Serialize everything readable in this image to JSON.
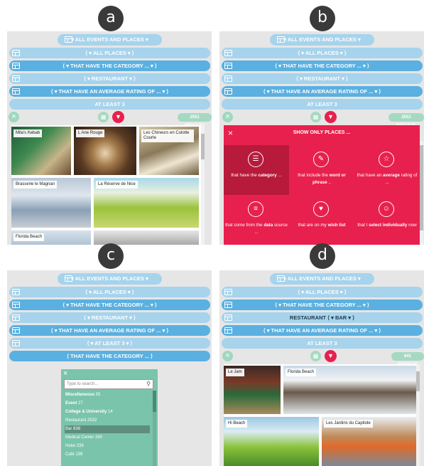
{
  "panels": [
    {
      "letter": "a",
      "bars": [
        "▾ ALL EVENTS AND PLACES ▾",
        "⟨ ▾ ALL PLACES ▾ ⟩",
        "⟨ ▾ THAT HAVE THE CATEGORY ... ▾ ⟩",
        "⟨ ▾ RESTAURANT ▾ ⟩",
        "⟨ ▾ THAT HAVE AN AVERAGE RATING OF ... ▾ ⟩",
        "AT LEAST 3"
      ],
      "results": "2551 RESULTS",
      "photos": [
        "Mila's Kebab",
        "L Ane Rouge",
        "Les Chineurs en Culotte Courte",
        "Brasserie le Magnan",
        "La Réserve de Nice",
        "Florida Beach"
      ]
    },
    {
      "letter": "b",
      "bars": [
        "▾ ALL EVENTS AND PLACES ▾",
        "⟨ ▾ ALL PLACES ▾ ⟩",
        "⟨ ▾ THAT HAVE THE CATEGORY ... ▾ ⟩",
        "⟨ ▾ RESTAURANT ▾ ⟩",
        "⟨ ▾ THAT HAVE AN AVERAGE RATING OF ... ▾ ⟩",
        "AT LEAST 3"
      ],
      "results": "2551 RESULTS",
      "popup_title": "SHOW ONLY PLACES ...",
      "options": [
        {
          "icon": "list-icon",
          "glyph": "☰",
          "pre": "that have the ",
          "bold": "category",
          "post": " ..."
        },
        {
          "icon": "pencil-icon",
          "glyph": "✎",
          "pre": "that include the ",
          "bold": "word or phrase",
          "post": " .."
        },
        {
          "icon": "star-icon",
          "glyph": "☆",
          "pre": "that have an ",
          "bold": "average",
          "post": " rating of ..."
        },
        {
          "icon": "data-source-icon",
          "glyph": "≡",
          "pre": "that come from the ",
          "bold": "data",
          "post": " source ..."
        },
        {
          "icon": "heart-icon",
          "glyph": "♥",
          "pre": "that are on my ",
          "bold": "wish list",
          "post": ""
        },
        {
          "icon": "person-icon",
          "glyph": "☺",
          "pre": "that I ",
          "bold": "select individually",
          "post": " now"
        }
      ]
    },
    {
      "letter": "c",
      "bars": [
        "▾ ALL EVENTS AND PLACES ▾",
        "⟨ ▾ ALL PLACES ▾ ⟩",
        "⟨ ▾ THAT HAVE THE CATEGORY ... ▾ ⟩",
        "⟨ ▾ RESTAURANT ▾ ⟩",
        "⟨ ▾ THAT HAVE AN AVERAGE RATING OF ... ▾ ⟩",
        "⟨ ▾ AT LEAST 3 ▾ ⟩",
        "⟨ THAT HAVE THE CATEGORY ... ⟩"
      ],
      "search_placeholder": "Type to search...",
      "items": [
        {
          "name": "Miscellaneous",
          "count": "55",
          "bold": true
        },
        {
          "name": "Event",
          "count": "27",
          "bold": true
        },
        {
          "name": "College & University",
          "count": "14",
          "bold": true
        },
        {
          "name": "Restaurant",
          "count": "2532",
          "bold": false
        },
        {
          "name": "Bar",
          "count": "838",
          "bold": false
        },
        {
          "name": "Medical Center",
          "count": "260",
          "bold": false
        },
        {
          "name": "Hotel",
          "count": "239",
          "bold": false
        },
        {
          "name": "Café",
          "count": "199",
          "bold": false
        }
      ]
    },
    {
      "letter": "d",
      "bars": [
        "▾ ALL EVENTS AND PLACES ▾",
        "⟨ ▾ ALL PLACES ▾ ⟩",
        "⟨ ▾ THAT HAVE THE CATEGORY ... ▾ ⟩",
        "RESTAURANT ⟨ ▾ BAR ▾ ⟩",
        "⟨ ▾ THAT HAVE AN AVERAGE RATING OF ... ▾ ⟩",
        "AT LEAST 3"
      ],
      "results": "841 RESULTS",
      "photos": [
        "Le Jam",
        "Florida Beach",
        "Hi Beach",
        "Les Jardins du Capitole"
      ]
    }
  ],
  "colors": {
    "light_bar": "#a7d3ec",
    "dark_bar": "#5ab0e0",
    "pink": "#e8204d",
    "green": "#a6d9c2",
    "panel_bg": "#e6e6e6"
  }
}
